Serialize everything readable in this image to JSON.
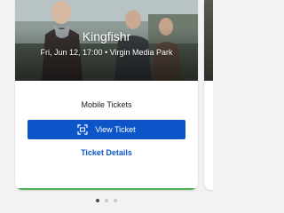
{
  "event": {
    "title": "Kingfishr",
    "subtitle": "Fri, Jun 12, 17:00 • Virgin Media Park"
  },
  "ticket": {
    "type_label": "Mobile Tickets",
    "view_button_label": "View Ticket",
    "view_button_icon": "qr-scan-icon",
    "details_link_label": "Ticket Details"
  },
  "pager": {
    "page_count": 3,
    "current_page": 1
  },
  "colors": {
    "primary": "#0b55c9",
    "accent_strip": "#4caf50"
  }
}
